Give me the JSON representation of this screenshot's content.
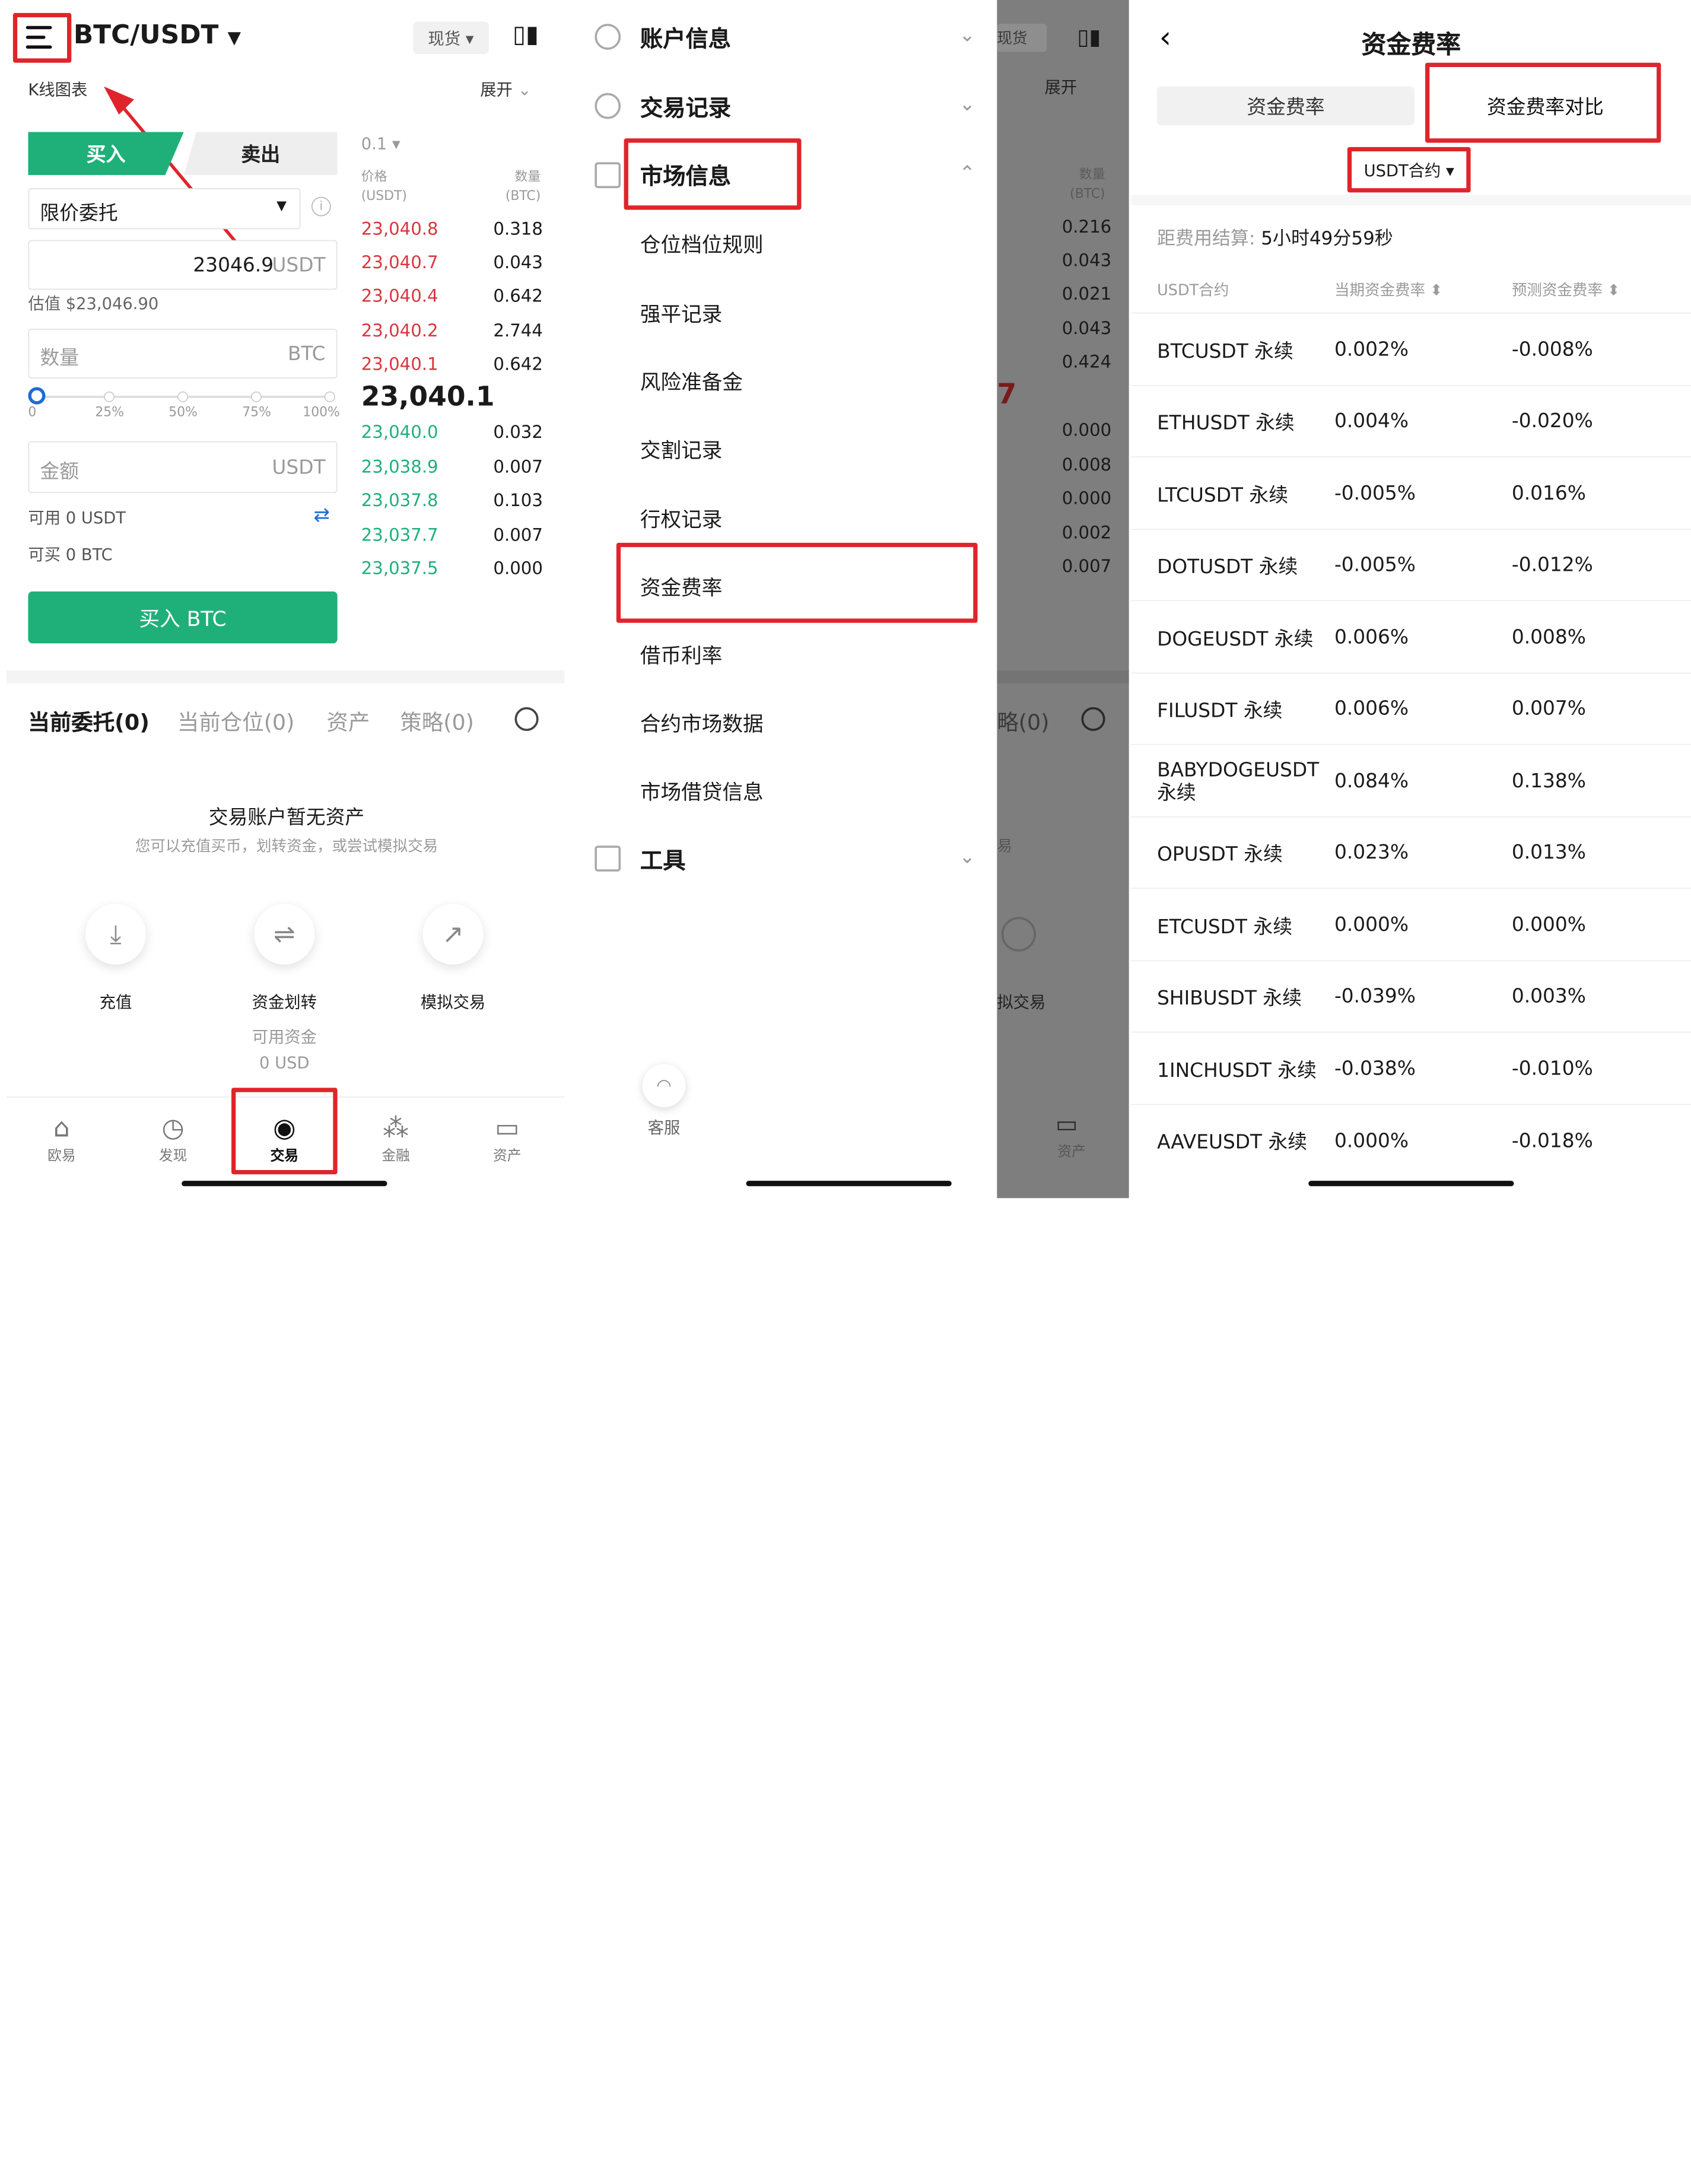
{
  "panel1": {
    "pair": "BTC/USDT",
    "pair_arrow": "▼",
    "spot_chip": "现货 ▾",
    "kline": "K线图表",
    "expand": "展开",
    "buy_tab": "买入",
    "sell_tab": "卖出",
    "order_type": "限价委托",
    "price_value": "23046.9",
    "price_unit": "USDT",
    "estimate": "估值 $23,046.90",
    "qty_placeholder": "数量",
    "qty_unit": "BTC",
    "slider": [
      "0",
      "25%",
      "50%",
      "75%",
      "100%"
    ],
    "amount_placeholder": "金额",
    "amount_unit": "USDT",
    "available": "可用 0 USDT",
    "can_buy": "可买 0 BTC",
    "buy_button": "买入 BTC",
    "ob_precision": "0.1 ▾",
    "ob_price_header": "价格\n(USDT)",
    "ob_qty_header": "数量\n(BTC)",
    "asks": [
      [
        "23,040.8",
        "0.318"
      ],
      [
        "23,040.7",
        "0.043"
      ],
      [
        "23,040.4",
        "0.642"
      ],
      [
        "23,040.2",
        "2.744"
      ],
      [
        "23,040.1",
        "0.642"
      ]
    ],
    "last_price": "23,040.1",
    "bids": [
      [
        "23,040.0",
        "0.032"
      ],
      [
        "23,038.9",
        "0.007"
      ],
      [
        "23,037.8",
        "0.103"
      ],
      [
        "23,037.7",
        "0.007"
      ],
      [
        "23,037.5",
        "0.000"
      ]
    ],
    "tabs": [
      "当前委托(0)",
      "当前仓位(0)",
      "资产",
      "策略(0)"
    ],
    "empty_title": "交易账户暂无资产",
    "empty_sub": "您可以充值买币，划转资金，或尝试模拟交易",
    "actions": [
      {
        "label": "充值"
      },
      {
        "label": "资金划转"
      },
      {
        "label": "模拟交易"
      }
    ],
    "avail_funds_label": "可用资金",
    "avail_funds_value": "0 USD",
    "nav": [
      {
        "label": "欧易",
        "icon": "home-icon"
      },
      {
        "label": "发现",
        "icon": "discover-icon"
      },
      {
        "label": "交易",
        "icon": "trade-icon"
      },
      {
        "label": "金融",
        "icon": "finance-icon"
      },
      {
        "label": "资产",
        "icon": "wallet-icon"
      }
    ]
  },
  "panel2": {
    "sections": [
      "账户信息",
      "交易记录",
      "市场信息",
      "工具"
    ],
    "market_items": [
      "仓位档位规则",
      "强平记录",
      "风险准备金",
      "交割记录",
      "行权记录",
      "资金费率",
      "借币利率",
      "合约市场数据",
      "市场借贷信息"
    ],
    "support": "客服"
  },
  "panel3": {
    "spot_chip": "现货",
    "expand": "展开",
    "qty_header": "数量\n(BTC)",
    "asks": [
      "0.216",
      "0.043",
      "0.021",
      "0.043",
      "0.424"
    ],
    "bids": [
      "0.000",
      "0.008",
      "0.000",
      "0.002",
      "0.007"
    ],
    "big_digit": "7",
    "tab_frag": "略(0)",
    "empty_frag": "易",
    "action_frag": "拟交易",
    "nav": "资产"
  },
  "panel4": {
    "title": "资金费率",
    "tab1": "资金费率",
    "tab2": "资金费率对比",
    "contract_select": "USDT合约 ▾",
    "countdown_label": "距费用结算:",
    "countdown_value": "5小时49分59秒",
    "headers": [
      "USDT合约",
      "当期资金费率 ⬍",
      "预测资金费率 ⬍"
    ],
    "rows": [
      [
        "BTCUSDT 永续",
        "0.002%",
        "-0.008%"
      ],
      [
        "ETHUSDT 永续",
        "0.004%",
        "-0.020%"
      ],
      [
        "LTCUSDT 永续",
        "-0.005%",
        "0.016%"
      ],
      [
        "DOTUSDT 永续",
        "-0.005%",
        "-0.012%"
      ],
      [
        "DOGEUSDT 永续",
        "0.006%",
        "0.008%"
      ],
      [
        "FILUSDT 永续",
        "0.006%",
        "0.007%"
      ],
      [
        "BABYDOGEUSDT\n永续",
        "0.084%",
        "0.138%"
      ],
      [
        "OPUSDT 永续",
        "0.023%",
        "0.013%"
      ],
      [
        "ETCUSDT 永续",
        "0.000%",
        "0.000%"
      ],
      [
        "SHIBUSDT 永续",
        "-0.039%",
        "0.003%"
      ],
      [
        "1INCHUSDT 永续",
        "-0.038%",
        "-0.010%"
      ],
      [
        "AAVEUSDT 永续",
        "0.000%",
        "-0.018%"
      ]
    ]
  },
  "colors": {
    "green": "#1fb07a",
    "red": "#d9363e",
    "highlight": "#e0242b"
  }
}
